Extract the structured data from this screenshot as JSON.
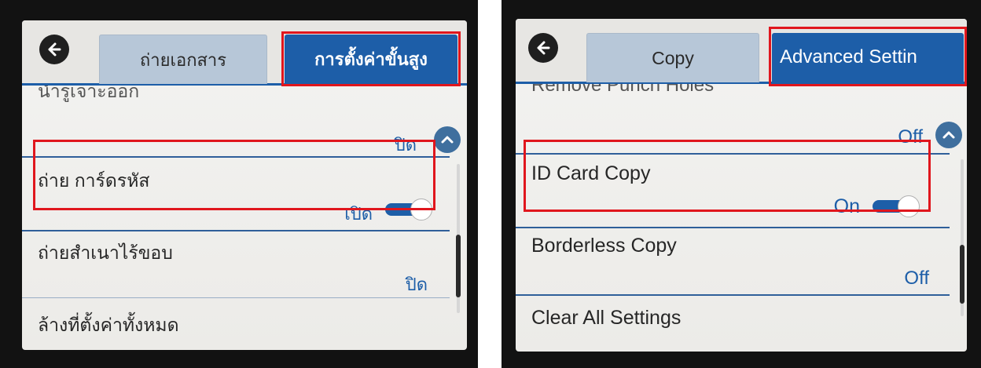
{
  "left_panel": {
    "tabs": [
      "ถ่ายเอกสาร",
      "การตั้งค่าขั้นสูง"
    ],
    "partial_item": "นำรูเจาะออก",
    "items": [
      {
        "label": "",
        "value": "ปิด"
      },
      {
        "label": "ถ่าย การ์ดรหัส",
        "value": "เปิด"
      },
      {
        "label": "ถ่ายสำเนาไร้ขอบ",
        "value": "ปิด"
      },
      {
        "label": "ล้างที่ตั้งค่าทั้งหมด",
        "value": ""
      }
    ],
    "toggle_on": true
  },
  "right_panel": {
    "tabs": [
      "Copy",
      "Advanced Settin"
    ],
    "partial_item": "Remove Punch Holes",
    "items": [
      {
        "label": "",
        "value": "Off"
      },
      {
        "label": "ID Card Copy",
        "value": "On"
      },
      {
        "label": "Borderless Copy",
        "value": "Off"
      },
      {
        "label": "Clear All Settings",
        "value": ""
      }
    ],
    "toggle_on": true
  },
  "colors": {
    "accent": "#1d5ea8",
    "highlight": "#e0161d",
    "tab_inactive": "#b7c7d8"
  },
  "icons": [
    "back-arrow-icon",
    "chevron-up-icon",
    "toggle-switch-icon"
  ]
}
